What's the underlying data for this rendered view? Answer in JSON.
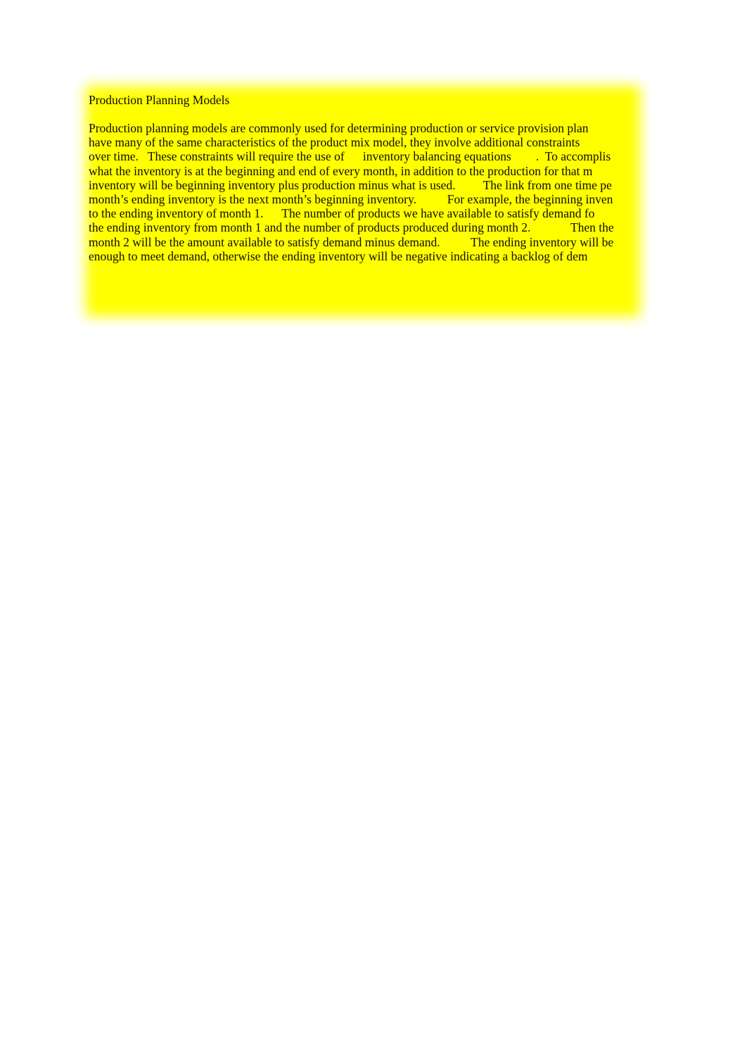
{
  "document": {
    "title": "Production Planning Models",
    "highlight_color": "#ffff00",
    "text_color": "#100c08",
    "page_background": "#ffffff",
    "heading": "Production Planning Models",
    "body_lines": [
      "Production planning models are commonly used for determining production or service provision plan",
      "have many of the same characteristics of the product mix model, they involve additional constraints",
      "over time.   These constraints will require the use of      inventory balancing equations        .  To accomplis",
      "what the inventory is at the beginning and end of every month, in addition to the production for that m",
      "inventory will be beginning inventory plus production minus what is used.         The link from one time pe",
      "month’s ending inventory is the next month’s beginning inventory.          For example, the beginning inven",
      "to the ending inventory of month 1.      The number of products we have available to satisfy demand fo",
      "the ending inventory from month 1 and the number of products produced during month 2.             Then the",
      "month 2 will be the amount available to satisfy demand minus demand.          The ending inventory will be",
      "enough to meet demand, otherwise the ending inventory will be negative indicating a backlog of dem"
    ]
  }
}
